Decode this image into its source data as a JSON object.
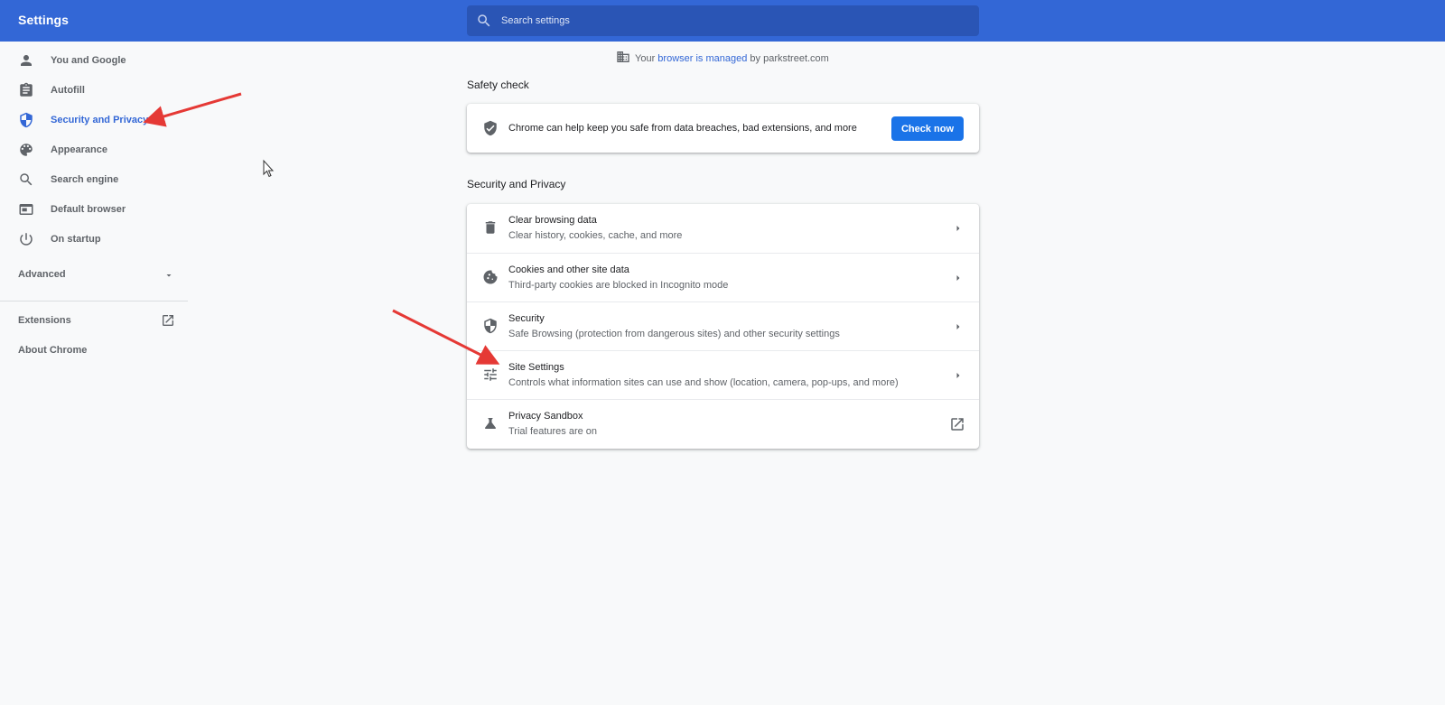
{
  "header": {
    "title": "Settings",
    "search_placeholder": "Search settings"
  },
  "sidebar": {
    "items": [
      {
        "label": "You and Google",
        "icon": "person-icon"
      },
      {
        "label": "Autofill",
        "icon": "clipboard-icon"
      },
      {
        "label": "Security and Privacy",
        "icon": "shield-icon",
        "active": true
      },
      {
        "label": "Appearance",
        "icon": "palette-icon"
      },
      {
        "label": "Search engine",
        "icon": "search-icon"
      },
      {
        "label": "Default browser",
        "icon": "browser-window-icon"
      },
      {
        "label": "On startup",
        "icon": "power-icon"
      }
    ],
    "advanced_label": "Advanced",
    "extensions_label": "Extensions",
    "about_label": "About Chrome"
  },
  "managed": {
    "prefix": "Your",
    "link": "browser is managed",
    "suffix": "by parkstreet.com"
  },
  "safety_check": {
    "title": "Safety check",
    "description": "Chrome can help keep you safe from data breaches, bad extensions, and more",
    "button_label": "Check now"
  },
  "security_privacy": {
    "title": "Security and Privacy",
    "rows": [
      {
        "title": "Clear browsing data",
        "subtitle": "Clear history, cookies, cache, and more"
      },
      {
        "title": "Cookies and other site data",
        "subtitle": "Third-party cookies are blocked in Incognito mode"
      },
      {
        "title": "Security",
        "subtitle": "Safe Browsing (protection from dangerous sites) and other security settings"
      },
      {
        "title": "Site Settings",
        "subtitle": "Controls what information sites can use and show (location, camera, pop-ups, and more)"
      },
      {
        "title": "Privacy Sandbox",
        "subtitle": "Trial features are on"
      }
    ]
  },
  "colors": {
    "header_bg": "#3367d6",
    "accent": "#3367d6",
    "button": "#1a73e8",
    "annotation_arrow": "#e53935"
  }
}
